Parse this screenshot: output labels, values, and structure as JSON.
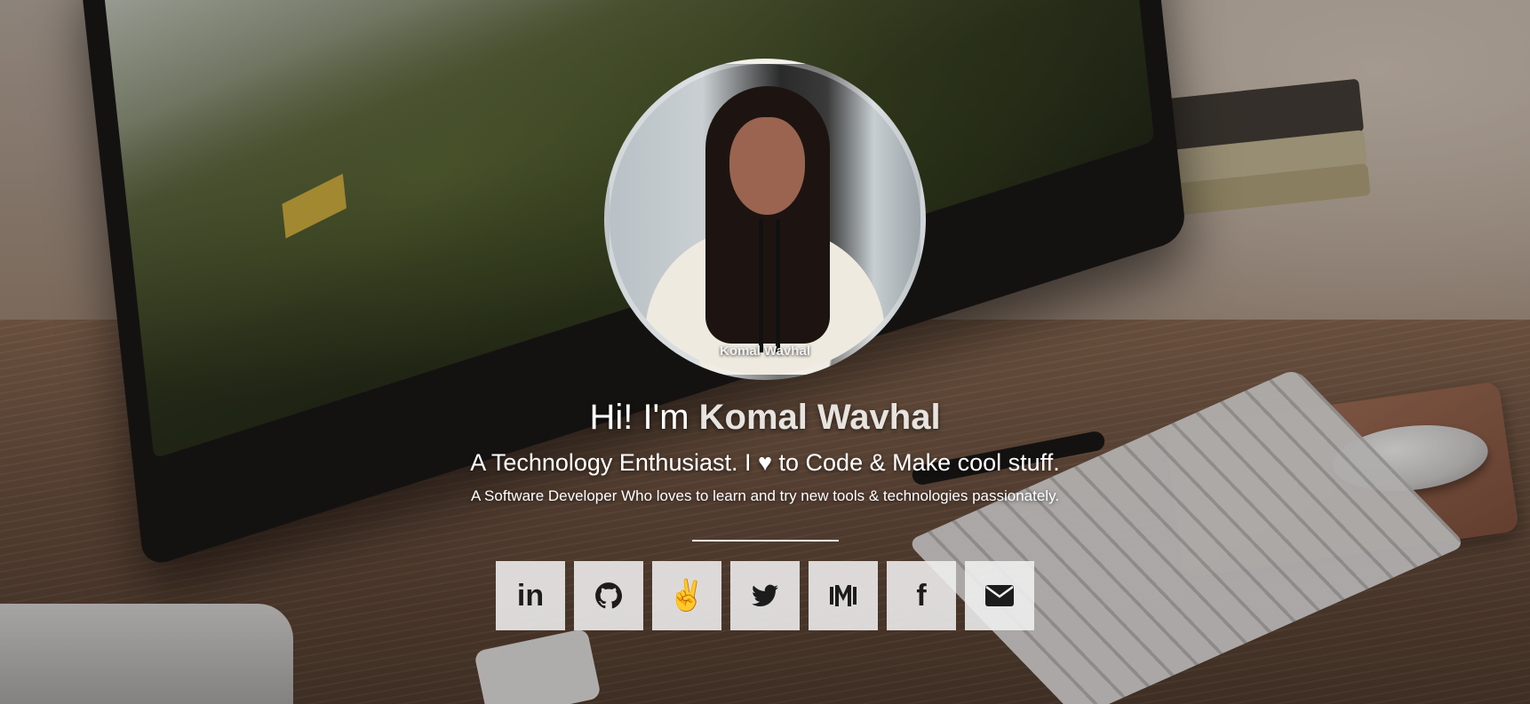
{
  "profile": {
    "photo_caption": "Komal Wavhal",
    "greeting_prefix": "Hi! I'm",
    "name": "Komal Wavhal",
    "tagline": "A Technology Enthusiast. I ♥ to Code & Make cool stuff.",
    "description": "A Software Developer Who loves to learn and try new tools & technologies passionately."
  },
  "social": [
    {
      "icon": "linkedin-icon",
      "text": "in"
    },
    {
      "icon": "github-icon"
    },
    {
      "icon": "angellist-icon",
      "text": "✌"
    },
    {
      "icon": "twitter-icon"
    },
    {
      "icon": "medium-icon"
    },
    {
      "icon": "facebook-icon",
      "text": "f"
    },
    {
      "icon": "email-icon"
    }
  ],
  "colors": {
    "overlay": "#1e1612",
    "button_bg": "#f0f0f0",
    "icon": "#1c1c1c",
    "text": "#ffffff"
  }
}
